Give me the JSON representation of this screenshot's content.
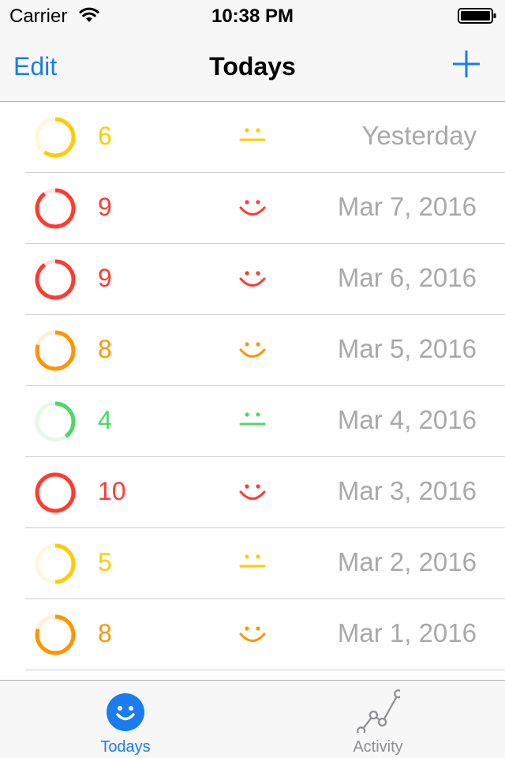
{
  "status_bar": {
    "carrier": "Carrier",
    "time": "10:38 PM"
  },
  "nav": {
    "edit_label": "Edit",
    "title": "Todays",
    "add_icon": "plus-icon"
  },
  "colors": {
    "accent": "#1a7cf0",
    "yellow": "#ffcc00",
    "orange": "#ff9500",
    "red": "#ff3b30",
    "green": "#4cd964",
    "date_gray": "#a9a9a9"
  },
  "entries": [
    {
      "score": "6",
      "mood": "neutral",
      "color": "#ffcc00",
      "date": "Yesterday"
    },
    {
      "score": "9",
      "mood": "happy",
      "color": "#ff3b30",
      "date": "Mar 7, 2016"
    },
    {
      "score": "9",
      "mood": "happy",
      "color": "#ff3b30",
      "date": "Mar 6, 2016"
    },
    {
      "score": "8",
      "mood": "happy",
      "color": "#ff9500",
      "date": "Mar 5, 2016"
    },
    {
      "score": "4",
      "mood": "neutral",
      "color": "#4cd964",
      "date": "Mar 4, 2016"
    },
    {
      "score": "10",
      "mood": "happy",
      "color": "#ff3b30",
      "date": "Mar 3, 2016"
    },
    {
      "score": "5",
      "mood": "neutral",
      "color": "#ffcc00",
      "date": "Mar 2, 2016"
    },
    {
      "score": "8",
      "mood": "happy",
      "color": "#ff9500",
      "date": "Mar 1, 2016"
    }
  ],
  "tabs": [
    {
      "label": "Todays",
      "icon": "smiley-icon",
      "selected": true
    },
    {
      "label": "Activity",
      "icon": "line-chart-icon",
      "selected": false
    }
  ]
}
